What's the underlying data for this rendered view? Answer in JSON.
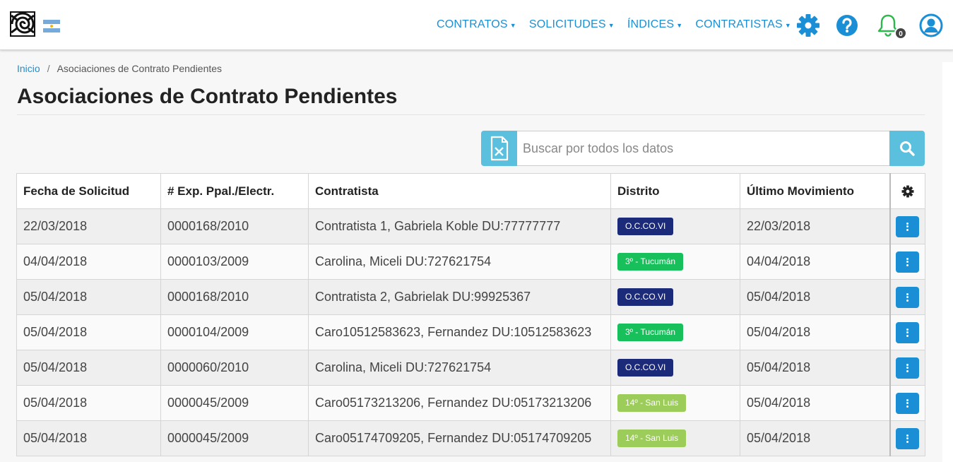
{
  "nav": {
    "items": [
      {
        "label": "CONTRATOS",
        "name": "nav-contratos"
      },
      {
        "label": "SOLICITUDES",
        "name": "nav-solicitudes"
      },
      {
        "label": "ÍNDICES",
        "name": "nav-indices"
      },
      {
        "label": "CONTRATISTAS",
        "name": "nav-contratistas"
      }
    ],
    "notification_count": "0",
    "accent_color": "#1b8fd6"
  },
  "breadcrumb": {
    "home": "Inicio",
    "separator": "/",
    "current": "Asociaciones de Contrato Pendientes"
  },
  "page": {
    "title": "Asociaciones de Contrato Pendientes"
  },
  "search": {
    "placeholder": "Buscar por todos los datos",
    "value": ""
  },
  "table": {
    "headers": [
      "Fecha de Solicitud",
      "# Exp. Ppal./Electr.",
      "Contratista",
      "Distrito",
      "Último Movimiento"
    ],
    "rows": [
      {
        "fecha": "22/03/2018",
        "exp": "0000168/2010",
        "contratista": "Contratista 1, Gabriela Koble DU:77777777",
        "distrito": "O.C.CO.VI",
        "distrito_color": "#1c2a7a",
        "ultimo": "22/03/2018"
      },
      {
        "fecha": "04/04/2018",
        "exp": "0000103/2009",
        "contratista": "Carolina, Miceli DU:727621754",
        "distrito": "3º - Tucumán",
        "distrito_color": "#17c05a",
        "ultimo": "04/04/2018"
      },
      {
        "fecha": "05/04/2018",
        "exp": "0000168/2010",
        "contratista": "Contratista 2, Gabrielak DU:99925367",
        "distrito": "O.C.CO.VI",
        "distrito_color": "#1c2a7a",
        "ultimo": "05/04/2018"
      },
      {
        "fecha": "05/04/2018",
        "exp": "0000104/2009",
        "contratista": "Caro10512583623, Fernandez DU:10512583623",
        "distrito": "3º - Tucumán",
        "distrito_color": "#17c05a",
        "ultimo": "05/04/2018"
      },
      {
        "fecha": "05/04/2018",
        "exp": "0000060/2010",
        "contratista": "Carolina, Miceli DU:727621754",
        "distrito": "O.C.CO.VI",
        "distrito_color": "#1c2a7a",
        "ultimo": "05/04/2018"
      },
      {
        "fecha": "05/04/2018",
        "exp": "0000045/2009",
        "contratista": "Caro05173213206, Fernandez DU:05173213206",
        "distrito": "14º - San Luis",
        "distrito_color": "#9ccc5a",
        "ultimo": "05/04/2018"
      },
      {
        "fecha": "05/04/2018",
        "exp": "0000045/2009",
        "contratista": "Caro05174709205, Fernandez DU:05174709205",
        "distrito": "14º - San Luis",
        "distrito_color": "#9ccc5a",
        "ultimo": "05/04/2018"
      }
    ]
  }
}
